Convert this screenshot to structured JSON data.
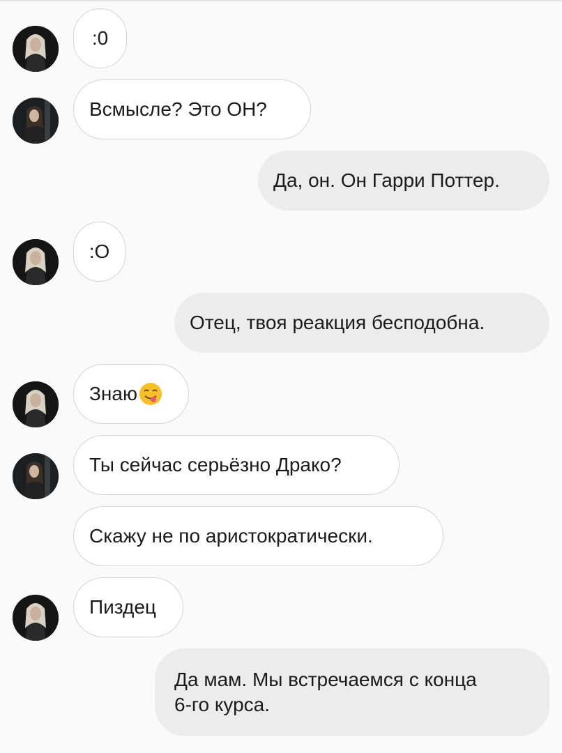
{
  "messages": [
    {
      "id": 1,
      "side": "in",
      "sender": "lucius",
      "text": ":0"
    },
    {
      "id": 2,
      "side": "in",
      "sender": "narcissa",
      "text": "Всмысле? Это ОН?"
    },
    {
      "id": 3,
      "side": "out",
      "text": "Да, он. Он Гарри Поттер."
    },
    {
      "id": 4,
      "side": "in",
      "sender": "lucius",
      "text": ":O"
    },
    {
      "id": 5,
      "side": "out",
      "text": "Отец, твоя реакция бесподобна."
    },
    {
      "id": 6,
      "side": "in",
      "sender": "lucius",
      "text": "Знаю",
      "emoji": "yum-face-icon"
    },
    {
      "id": 7,
      "side": "in",
      "sender": "narcissa",
      "text": "Ты сейчас серьёзно Драко?"
    },
    {
      "id": 8,
      "side": "in",
      "sender": "narcissa",
      "text": "Скажу не по аристократически."
    },
    {
      "id": 9,
      "side": "in",
      "sender": "lucius",
      "text": "Пиздец"
    },
    {
      "id": 10,
      "side": "out",
      "lines": [
        "Да мам. Мы встречаемся с конца",
        "6-го курса."
      ]
    }
  ],
  "colors": {
    "background": "#fafafa",
    "incoming_bubble": "#ffffff",
    "incoming_border": "#d4d4d4",
    "outgoing_bubble": "#ececec",
    "text": "#1b1b1b"
  }
}
